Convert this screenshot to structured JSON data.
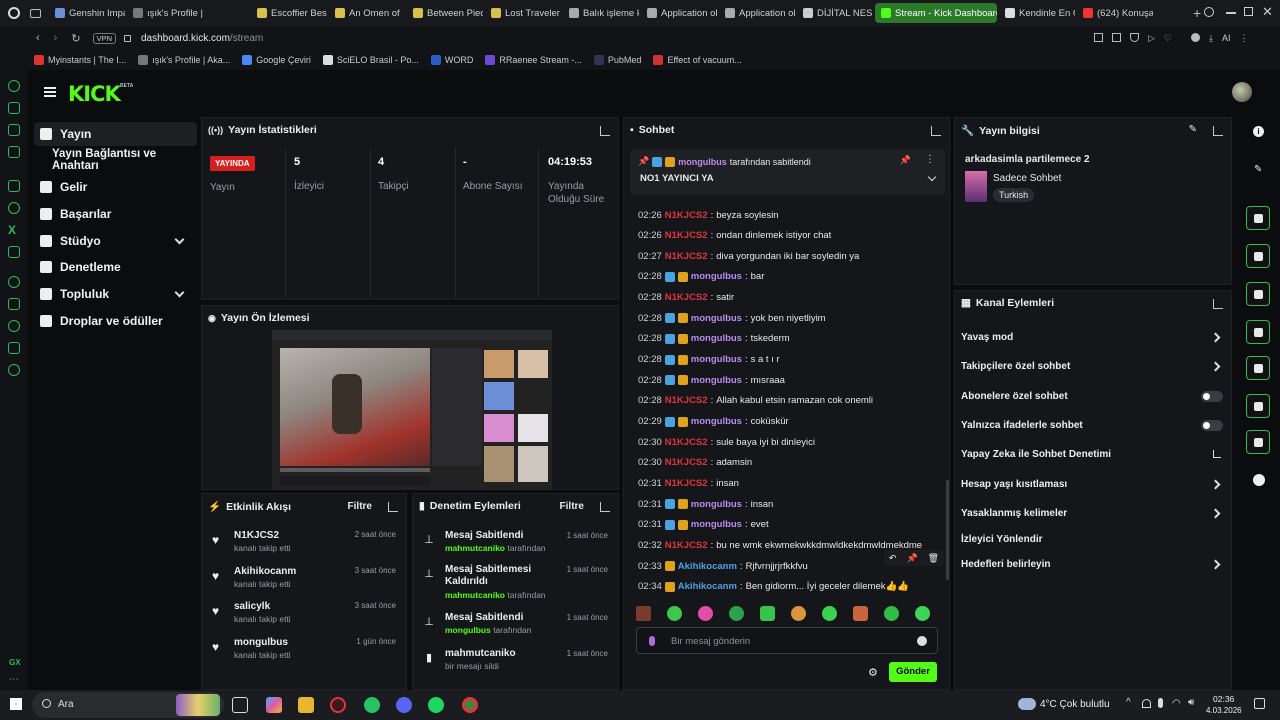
{
  "browser": {
    "tabs": [
      {
        "label": "Genshin Impac",
        "color": "#6d8fd6"
      },
      {
        "label": "ışık's Profile |",
        "color": "#777"
      },
      {
        "label": "Escoffier Bes",
        "color": "#d6c24a"
      },
      {
        "label": "An Omen of",
        "color": "#d6c24a"
      },
      {
        "label": "Between Pied",
        "color": "#d6c24a"
      },
      {
        "label": "Lost Traveler",
        "color": "#d6c24a"
      },
      {
        "label": "Balık işleme k",
        "color": "#aaa"
      },
      {
        "label": "Application ol",
        "color": "#aaa"
      },
      {
        "label": "Application ol",
        "color": "#aaa"
      },
      {
        "label": "DİJİTAL NESN",
        "color": "#ccc"
      },
      {
        "label": "Stream - Kick Dashboard",
        "color": "#53fc18"
      },
      {
        "label": "Kendinle En Ç",
        "color": "#ddd"
      },
      {
        "label": "(624) Konuşan",
        "color": "#e33"
      }
    ],
    "url_domain": "dashboard.kick.com",
    "url_path": "/stream",
    "vpn_label": "VPN",
    "bookmarks": [
      {
        "label": "Myinstants | The I...",
        "color": "#d33"
      },
      {
        "label": "ışık's Profile | Aka...",
        "color": "#777"
      },
      {
        "label": "Google Çeviri",
        "color": "#4a8af4"
      },
      {
        "label": "SciELO Brasil - Po...",
        "color": "#ddd"
      },
      {
        "label": "WORD",
        "color": "#2b5cc5"
      },
      {
        "label": "RRaenee Stream -...",
        "color": "#6b4ad6"
      },
      {
        "label": "PubMed",
        "color": "#335"
      },
      {
        "label": "Effect of vacuum...",
        "color": "#c33"
      }
    ]
  },
  "kick": {
    "logo": "KICK",
    "beta": "BETA"
  },
  "sidenav": [
    {
      "label": "Yayın",
      "icon": "stream-icon"
    },
    {
      "label": "Yayın Bağlantısı ve Anahtarı",
      "icon": ""
    },
    {
      "label": "Gelir",
      "icon": "chart-icon"
    },
    {
      "label": "Başarılar",
      "icon": "trophy-icon"
    },
    {
      "label": "Stüdyo",
      "icon": "studio-icon"
    },
    {
      "label": "Denetleme",
      "icon": "wrench-icon"
    },
    {
      "label": "Topluluk",
      "icon": "community-icon"
    },
    {
      "label": "Droplar ve ödüller",
      "icon": "gift-icon"
    }
  ],
  "stats": {
    "title": "Yayın İstatistikleri",
    "live_badge": "YAYINDA",
    "live_label": "Yayın",
    "viewers": "5",
    "viewers_label": "İzleyici",
    "followers": "4",
    "followers_label": "Takipçi",
    "subs": "-",
    "subs_label": "Abone Sayısı",
    "uptime": "04:19:53",
    "uptime_label": "Yayında Olduğu Süre"
  },
  "preview": {
    "title": "Yayın Ön İzlemesi"
  },
  "activity": {
    "title": "Etkinlik Akışı",
    "filter": "Filtre",
    "items": [
      {
        "name": "N1KJCS2",
        "sub": "kanalı takip etti",
        "time": "2 saat önce"
      },
      {
        "name": "Akihikocanm",
        "sub": "kanalı takip etti",
        "time": "3 saat önce"
      },
      {
        "name": "salicylk",
        "sub": "kanalı takip etti",
        "time": "3 saat önce"
      },
      {
        "name": "mongulbus",
        "sub": "kanalı takip etti",
        "time": "1 gün önce"
      }
    ]
  },
  "modactions": {
    "title": "Denetim Eylemleri",
    "filter": "Filtre",
    "items": [
      {
        "name": "Mesaj Sabitlendi",
        "user": "mahmutcaniko",
        "suffix": "tarafından",
        "time": "1 saat önce"
      },
      {
        "name": "Mesaj Sabitlemesi Kaldırıldı",
        "user": "mahmutcaniko",
        "suffix": "tarafından",
        "time": "1 saat önce"
      },
      {
        "name": "Mesaj Sabitlendi",
        "user": "mongulbus",
        "suffix": "tarafından",
        "time": "1 saat önce"
      },
      {
        "name": "mahmutcaniko",
        "user": "",
        "suffix": "bir mesajı sildi",
        "time": "1 saat önce"
      }
    ]
  },
  "chat": {
    "title": "Sohbet",
    "pinned_by": "mongulbus",
    "pinned_suffix": "tarafından sabitlendi",
    "pinned_msg": "NO1 YAYINCI YA",
    "messages": [
      {
        "time": "02:26",
        "user": "N1KJCS2",
        "color": "#e0343c",
        "text": "beyza soylesin",
        "badges": false
      },
      {
        "time": "02:26",
        "user": "N1KJCS2",
        "color": "#e0343c",
        "text": "ondan dinlemek istiyor chat",
        "badges": false
      },
      {
        "time": "02:27",
        "user": "N1KJCS2",
        "color": "#e0343c",
        "text": "diva yorgundan iki bar soyledin ya",
        "badges": false
      },
      {
        "time": "02:28",
        "user": "mongulbus",
        "color": "#b98cf0",
        "text": "bar",
        "badges": true
      },
      {
        "time": "02:28",
        "user": "N1KJCS2",
        "color": "#e0343c",
        "text": "satir",
        "badges": false
      },
      {
        "time": "02:28",
        "user": "mongulbus",
        "color": "#b98cf0",
        "text": "yok ben niyetliyim",
        "badges": true
      },
      {
        "time": "02:28",
        "user": "mongulbus",
        "color": "#b98cf0",
        "text": "tskederm",
        "badges": true
      },
      {
        "time": "02:28",
        "user": "mongulbus",
        "color": "#b98cf0",
        "text": "s a t ı r",
        "badges": true
      },
      {
        "time": "02:28",
        "user": "mongulbus",
        "color": "#b98cf0",
        "text": "mısraaa",
        "badges": true
      },
      {
        "time": "02:28",
        "user": "N1KJCS2",
        "color": "#e0343c",
        "text": "Allah kabul etsin ramazan cok onemli",
        "badges": false
      },
      {
        "time": "02:29",
        "user": "mongulbus",
        "color": "#b98cf0",
        "text": "coküskür",
        "badges": true
      },
      {
        "time": "02:30",
        "user": "N1KJCS2",
        "color": "#e0343c",
        "text": "sule baya iyi bi dinleyici",
        "badges": false
      },
      {
        "time": "02:30",
        "user": "N1KJCS2",
        "color": "#e0343c",
        "text": "adamsin",
        "badges": false
      },
      {
        "time": "02:31",
        "user": "N1KJCS2",
        "color": "#e0343c",
        "text": "insan",
        "badges": false
      },
      {
        "time": "02:31",
        "user": "mongulbus",
        "color": "#b98cf0",
        "text": "insan",
        "badges": true
      },
      {
        "time": "02:31",
        "user": "mongulbus",
        "color": "#b98cf0",
        "text": "evet",
        "badges": true
      },
      {
        "time": "02:32",
        "user": "N1KJCS2",
        "color": "#e0343c",
        "text": "bu ne wmk ekwmekwkkdmwldkekdmwldmekdme",
        "badges": false
      },
      {
        "time": "02:33",
        "user": "Akihikocanm",
        "color": "#4aa3df",
        "text": "Rjfvrnjjrjrfkkfvu",
        "badges": "gold"
      },
      {
        "time": "02:34",
        "user": "Akihikocanm",
        "color": "#4aa3df",
        "text": "Ben gidiorm... İyi geceler dilemek👍👍",
        "badges": "gold"
      }
    ],
    "input_placeholder": "Bir mesaj gönderin",
    "send": "Gönder"
  },
  "streaminfo": {
    "title": "Yayın bilgisi",
    "stream_title": "arkadasimla partilemece 2",
    "category": "Sadece Sohbet",
    "language": "Turkish"
  },
  "channelactions": {
    "title": "Kanal Eylemleri",
    "items": [
      {
        "label": "Yavaş mod",
        "kind": "arrow"
      },
      {
        "label": "Takipçilere özel sohbet",
        "kind": "arrow"
      },
      {
        "label": "Abonelere özel sohbet",
        "kind": "toggle"
      },
      {
        "label": "Yalnızca ifadelerle sohbet",
        "kind": "toggle"
      },
      {
        "label": "Yapay Zeka ile Sohbet Denetimi",
        "kind": "external"
      },
      {
        "label": "Hesap yaşı kısıtlaması",
        "kind": "arrow"
      },
      {
        "label": "Yasaklanmış kelimeler",
        "kind": "arrow"
      },
      {
        "label": "İzleyici Yönlendir",
        "kind": "none"
      },
      {
        "label": "Hedefleri belirleyin",
        "kind": "arrow"
      }
    ]
  },
  "taskbar": {
    "search": "Ara",
    "weather": "4°C  Çok bulutlu",
    "time": "02:36",
    "date": "4.03.2026"
  },
  "colors": {
    "accent": "#53fc18",
    "live": "#d61f1f"
  }
}
